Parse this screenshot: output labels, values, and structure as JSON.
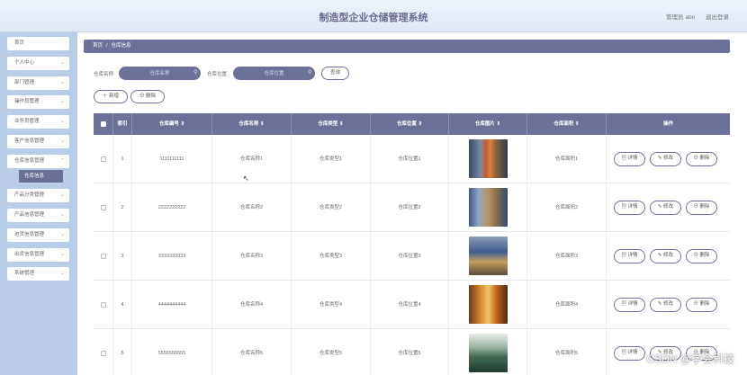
{
  "header": {
    "title": "制造型企业仓储管理系统",
    "user": "管理员 abo",
    "logout": "退出登录"
  },
  "sidebar": {
    "items": [
      {
        "label": "首页",
        "chev": false
      },
      {
        "label": "个人中心",
        "chev": true
      },
      {
        "label": "部门管理",
        "chev": true
      },
      {
        "label": "操作员管理",
        "chev": true
      },
      {
        "label": "业务员管理",
        "chev": true
      },
      {
        "label": "客户信息管理",
        "chev": true
      },
      {
        "label": "仓库信息管理",
        "chev": true
      },
      {
        "label": "产品分类管理",
        "chev": true
      },
      {
        "label": "产品信息管理",
        "chev": true
      },
      {
        "label": "进货信息管理",
        "chev": true
      },
      {
        "label": "出货信息管理",
        "chev": true
      },
      {
        "label": "系统管理",
        "chev": true
      }
    ],
    "sub": "仓库信息"
  },
  "breadcrumb": {
    "home": "首页",
    "sep": "/",
    "current": "仓库信息"
  },
  "search": {
    "name_label": "仓库名称",
    "name_placeholder": "仓库名称",
    "loc_label": "仓库位置",
    "loc_placeholder": "仓库位置",
    "query": "查询"
  },
  "toolbar": {
    "add": "＋ 新增",
    "delete": "⊖ 删除"
  },
  "table": {
    "headers": [
      "",
      "索引",
      "仓库编号 ⇕",
      "仓库名称 ⇕",
      "仓库类型 ⇕",
      "仓库位置 ⇕",
      "仓库图片 ⇕",
      "仓库面积 ⇕",
      "操作"
    ],
    "rows": [
      {
        "index": "1",
        "code": "1111111111",
        "name": "仓库名称1",
        "type": "仓库类型1",
        "location": "仓库位置1",
        "area": "仓库面积1"
      },
      {
        "index": "2",
        "code": "2222222222",
        "name": "仓库名称2",
        "type": "仓库类型2",
        "location": "仓库位置2",
        "area": "仓库面积2"
      },
      {
        "index": "3",
        "code": "3333333333",
        "name": "仓库名称3",
        "type": "仓库类型3",
        "location": "仓库位置3",
        "area": "仓库面积3"
      },
      {
        "index": "4",
        "code": "4444444444",
        "name": "仓库名称4",
        "type": "仓库类型4",
        "location": "仓库位置4",
        "area": "仓库面积4"
      },
      {
        "index": "5",
        "code": "5555555555",
        "name": "仓库名称5",
        "type": "仓库类型5",
        "location": "仓库位置5",
        "area": "仓库面积5"
      }
    ],
    "actions": {
      "detail": "▤ 详情",
      "edit": "✎ 修改",
      "remove": "⊖ 删除"
    }
  },
  "watermark": "CSDN @学会科技",
  "colors": {
    "accent": "#6d7199",
    "sidebar": "#b9cce8"
  }
}
